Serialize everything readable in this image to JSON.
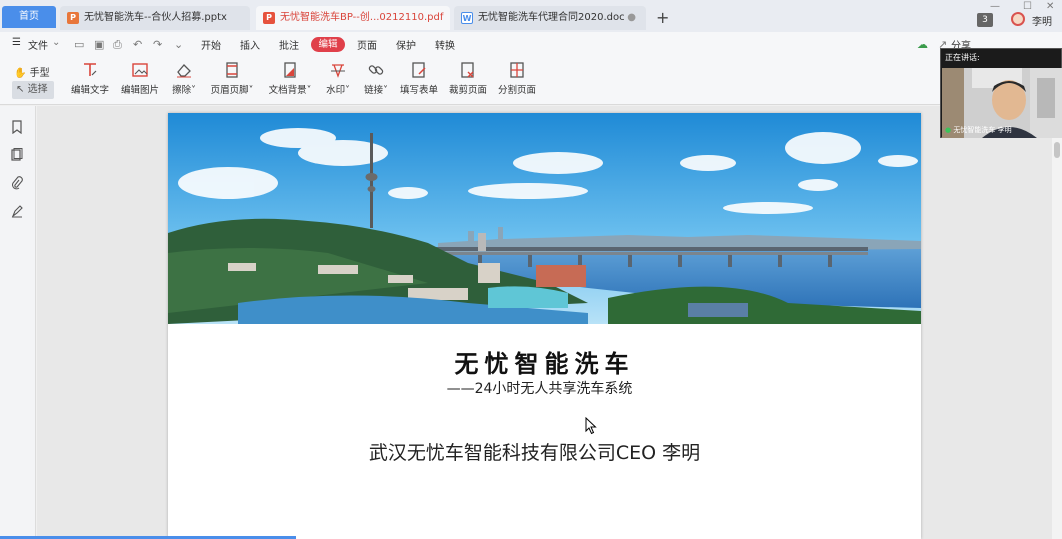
{
  "tabs": {
    "home": "首页",
    "docs": [
      {
        "name": "无忧智能洗车--合伙人招募.pptx",
        "icon": "P",
        "color": "#e8763a"
      },
      {
        "name": "无忧智能洗车BP--创...0212110.pdf",
        "icon": "P",
        "color": "#e6523d"
      },
      {
        "name": "无忧智能洗车代理合同2020.doc",
        "icon": "W",
        "color": "#4a8eea"
      }
    ],
    "count": "3",
    "user": "李明"
  },
  "menu": {
    "file": "文件",
    "items": [
      "开始",
      "插入",
      "批注",
      "编辑",
      "页面",
      "保护",
      "转换"
    ],
    "active": "编辑",
    "share": "分享"
  },
  "ribbon": {
    "hand": "手型",
    "select": "选择",
    "tools": [
      "编辑文字",
      "编辑图片",
      "擦除",
      "页眉页脚",
      "文档背景",
      "水印",
      "链接",
      "填写表单",
      "裁剪页面",
      "分割页面"
    ]
  },
  "document": {
    "title": "无忧智能洗车",
    "subtitle": "——24小时无人共享洗车系统",
    "company": "武汉无忧车智能科技有限公司CEO  李明"
  },
  "video": {
    "caption": "正在讲话:",
    "speaker": "无忧智能洗车 李明"
  },
  "colors": {
    "accent": "#4a8eea",
    "active_tab": "#e0404a"
  }
}
